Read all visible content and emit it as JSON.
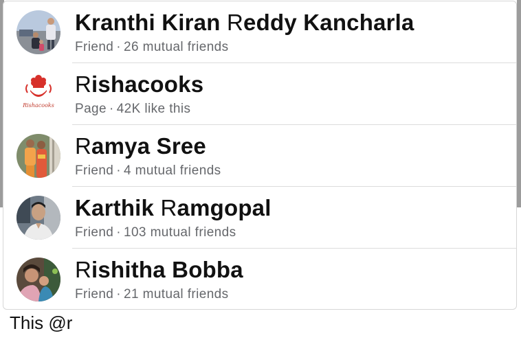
{
  "suggestions": [
    {
      "name_match": "",
      "name_rest_start": "Kranthi Kiran ",
      "name_hl": "R",
      "name_rest": "eddy Kancharla",
      "type": "Friend",
      "detail": "26 mutual friends",
      "avatar_icon": "profile-photo"
    },
    {
      "name_rest_start": "",
      "name_hl": "R",
      "name_rest": "ishacooks",
      "type": "Page",
      "detail": "42K like this",
      "avatar_icon": "rishacooks-logo",
      "logo_text": "Rishacooks"
    },
    {
      "name_rest_start": "",
      "name_hl": "R",
      "name_rest": "amya Sree",
      "type": "Friend",
      "detail": "4 mutual friends",
      "avatar_icon": "profile-photo"
    },
    {
      "name_rest_start": "Karthik ",
      "name_hl": "R",
      "name_rest": "amgopal",
      "type": "Friend",
      "detail": "103 mutual friends",
      "avatar_icon": "profile-photo"
    },
    {
      "name_rest_start": "",
      "name_hl": "R",
      "name_rest": "ishitha Bobba",
      "type": "Friend",
      "detail": "21 mutual friends",
      "avatar_icon": "profile-photo"
    }
  ],
  "separator": "·",
  "composer": {
    "text": "This @r"
  }
}
